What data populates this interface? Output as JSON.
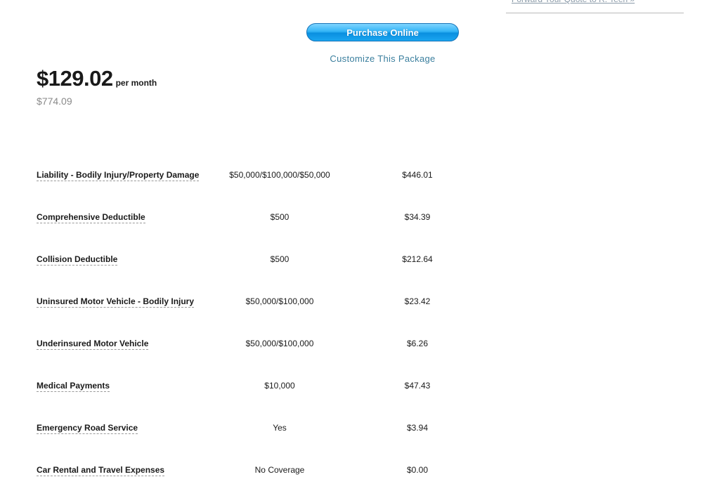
{
  "sidebar": {
    "forward_link": "Forward Your Quote to R. Teen »"
  },
  "actions": {
    "purchase_label": "Purchase Online",
    "customize_label": "Customize This Package"
  },
  "price": {
    "monthly": "$129.02",
    "period": "per month",
    "total": "$774.09"
  },
  "coverages": [
    {
      "name": "Liability - Bodily Injury/Property Damage",
      "limit": "$50,000/$100,000/$50,000",
      "premium": "$446.01"
    },
    {
      "name": "Comprehensive Deductible",
      "limit": "$500",
      "premium": "$34.39"
    },
    {
      "name": "Collision Deductible",
      "limit": "$500",
      "premium": "$212.64"
    },
    {
      "name": "Uninsured Motor Vehicle - Bodily Injury",
      "limit": "$50,000/$100,000",
      "premium": "$23.42"
    },
    {
      "name": "Underinsured Motor Vehicle",
      "limit": "$50,000/$100,000",
      "premium": "$6.26"
    },
    {
      "name": "Medical Payments",
      "limit": "$10,000",
      "premium": "$47.43"
    },
    {
      "name": "Emergency Road Service",
      "limit": "Yes",
      "premium": "$3.94"
    },
    {
      "name": "Car Rental and Travel Expenses",
      "limit": "No Coverage",
      "premium": "$0.00"
    }
  ]
}
